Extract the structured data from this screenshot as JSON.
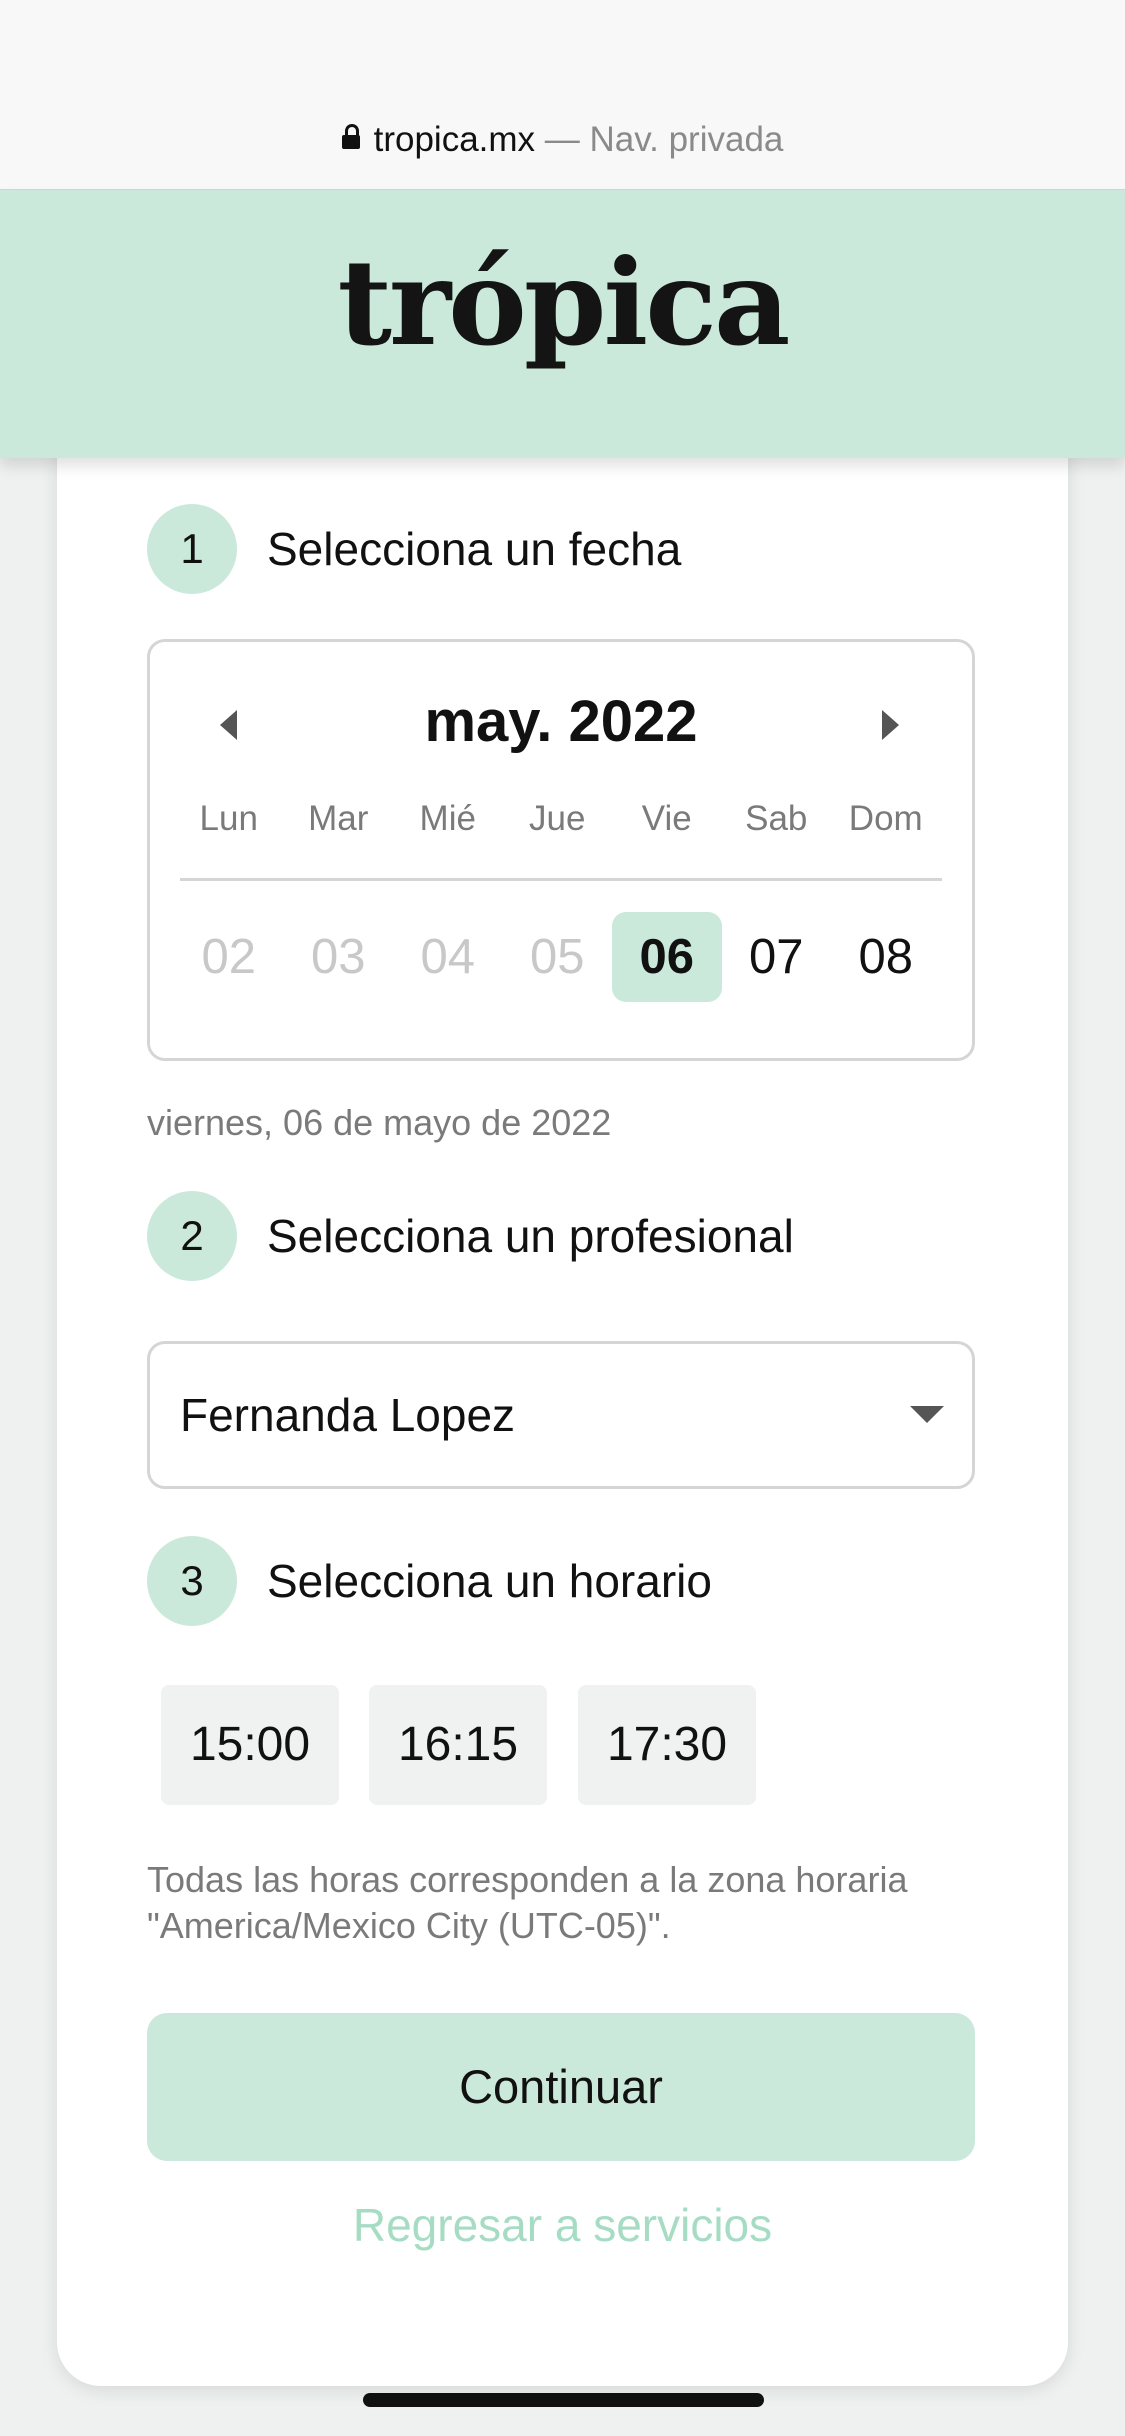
{
  "browser": {
    "domain": "tropica.mx",
    "private_label": " — Nav. privada"
  },
  "brand": {
    "logo_text": "trópica"
  },
  "step1": {
    "number": "1",
    "title": "Selecciona un fecha"
  },
  "calendar": {
    "month_label": "may. 2022",
    "weekdays": [
      "Lun",
      "Mar",
      "Mié",
      "Jue",
      "Vie",
      "Sab",
      "Dom"
    ],
    "days": [
      {
        "label": "02",
        "state": "disabled"
      },
      {
        "label": "03",
        "state": "disabled"
      },
      {
        "label": "04",
        "state": "disabled"
      },
      {
        "label": "05",
        "state": "disabled"
      },
      {
        "label": "06",
        "state": "selected"
      },
      {
        "label": "07",
        "state": "available"
      },
      {
        "label": "08",
        "state": "available"
      }
    ]
  },
  "selected_date_text": "viernes, 06 de mayo de 2022",
  "step2": {
    "number": "2",
    "title": "Selecciona un profesional",
    "selected_professional": "Fernanda Lopez"
  },
  "step3": {
    "number": "3",
    "title": "Selecciona un horario",
    "slots": [
      "15:00",
      "16:15",
      "17:30"
    ]
  },
  "timezone_note": "Todas las horas corresponden a la zona horaria \"America/Mexico City (UTC-05)\".",
  "actions": {
    "continue_label": "Continuar",
    "back_label": "Regresar a servicios"
  },
  "colors": {
    "accent": "#cbe9da",
    "link": "#a7dcc4",
    "muted_text": "#7a7a7a",
    "disabled_day": "#c8c8c8"
  }
}
